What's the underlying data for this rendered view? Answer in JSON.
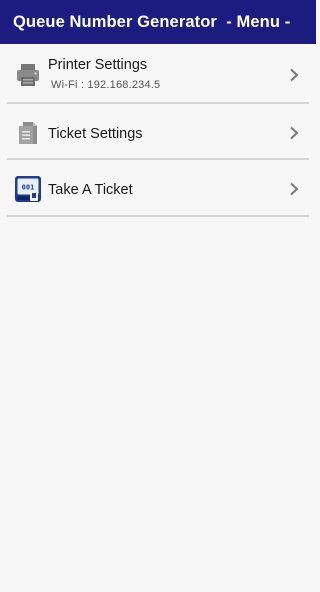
{
  "app_bar": {
    "title": "Queue Number Generator  - Menu -",
    "background": "#1c1c80"
  },
  "menu": {
    "items": [
      {
        "label": "Printer Settings",
        "subtitle": "Wi-Fi : 192.168.234.5",
        "icon": "printer-icon",
        "chevron": "chevron-right-icon"
      },
      {
        "label": "Ticket Settings",
        "icon": "document-icon",
        "chevron": "chevron-right-icon"
      },
      {
        "label": "Take A Ticket",
        "icon": "ticket-machine-icon",
        "icon_text": "001",
        "chevron": "chevron-right-icon"
      }
    ]
  }
}
